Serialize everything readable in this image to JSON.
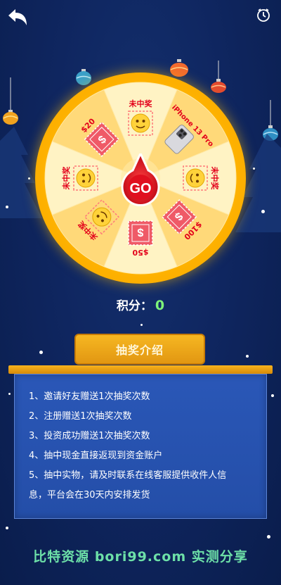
{
  "header": {
    "back_icon": "back-arrow-icon",
    "history_icon": "clock-history-icon"
  },
  "wheel": {
    "segments": [
      {
        "label": "未中奖",
        "prize_icon": "smiley-face-icon"
      },
      {
        "label": "iPhone 13 Pro",
        "prize_icon": "iphone-icon"
      },
      {
        "label": "未中奖",
        "prize_icon": "smiley-face-icon"
      },
      {
        "label": "$100",
        "prize_icon": "dollar-coupon-icon"
      },
      {
        "label": "$50",
        "prize_icon": "dollar-coupon-icon"
      },
      {
        "label": "未中奖",
        "prize_icon": "smiley-face-icon"
      },
      {
        "label": "未中奖",
        "prize_icon": "smiley-face-icon"
      },
      {
        "label": "$20",
        "prize_icon": "dollar-coupon-icon"
      }
    ],
    "go_label": "GO",
    "colors": {
      "rim": "#ffb400",
      "light": "#fff3c4",
      "gold": "#ffd979",
      "text": "#e3001b",
      "go": "#d90f1f"
    }
  },
  "score": {
    "label": "积分：",
    "value": "0"
  },
  "intro": {
    "tab_label": "抽奖介绍",
    "rules": [
      "1、邀请好友赠送1次抽奖次数",
      "2、注册赠送1次抽奖次数",
      "3、投资成功赠送1次抽奖次数",
      "4、抽中现金直接返现到资金账户",
      "5、抽中实物，请及时联系在线客服提供收件人信",
      "息，平台会在30天内安排发货"
    ]
  },
  "footer": {
    "watermark": "比特资源  bori99.com  实测分享"
  }
}
